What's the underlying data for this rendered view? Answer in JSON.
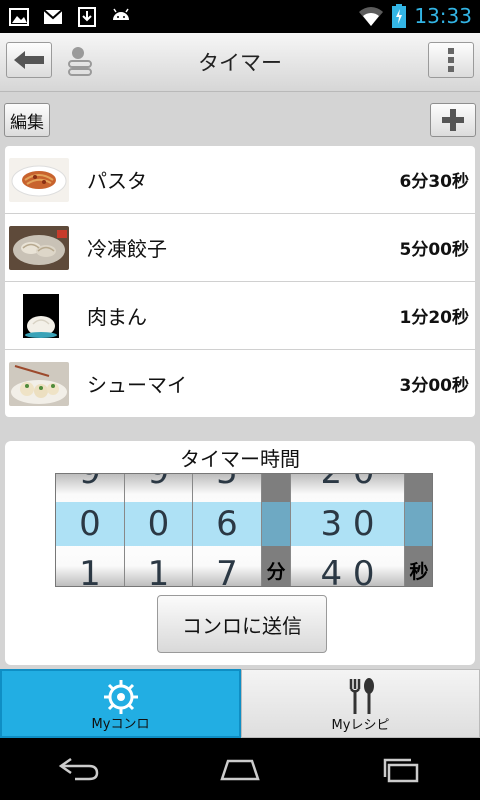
{
  "status_bar": {
    "time": "13:33",
    "icons": [
      "image-icon",
      "gmail-icon",
      "download-icon",
      "android-icon",
      "wifi-icon",
      "battery-charging-icon"
    ]
  },
  "header": {
    "title": "タイマー",
    "back_icon": "arrow-left-icon",
    "user_icon": "user-icon",
    "menu_icon": "overflow-menu-icon"
  },
  "toolbar": {
    "edit_label": "編集",
    "add_icon": "plus-icon"
  },
  "timers": [
    {
      "name": "パスタ",
      "time": "6分30秒",
      "thumb": "pasta-thumbnail"
    },
    {
      "name": "冷凍餃子",
      "time": "5分00秒",
      "thumb": "gyoza-thumbnail"
    },
    {
      "name": "肉まん",
      "time": "1分20秒",
      "thumb": "nikuman-thumbnail"
    },
    {
      "name": "シューマイ",
      "time": "3分00秒",
      "thumb": "shumai-thumbnail"
    }
  ],
  "timer_panel": {
    "title": "タイマー時間",
    "minutes_digits": [
      {
        "prev": "9",
        "current": "0",
        "next": "1"
      },
      {
        "prev": "9",
        "current": "0",
        "next": "1"
      },
      {
        "prev": "5",
        "current": "6",
        "next": "7"
      }
    ],
    "minutes_unit": "分",
    "seconds": {
      "prev": "2 0",
      "current": "3 0",
      "next": "4 0"
    },
    "seconds_unit": "秒",
    "send_label": "コンロに送信"
  },
  "tabs": [
    {
      "label": "Myコンロ",
      "icon": "stove-icon",
      "active": true
    },
    {
      "label": "Myレシピ",
      "icon": "fork-spoon-icon",
      "active": false
    }
  ],
  "nav_bar": {
    "icons": [
      "back-nav-icon",
      "home-nav-icon",
      "recents-nav-icon"
    ]
  },
  "colors": {
    "accent": "#22aee3",
    "picker_highlight": "#aee1f5",
    "status_icons": "#33b5e5"
  }
}
